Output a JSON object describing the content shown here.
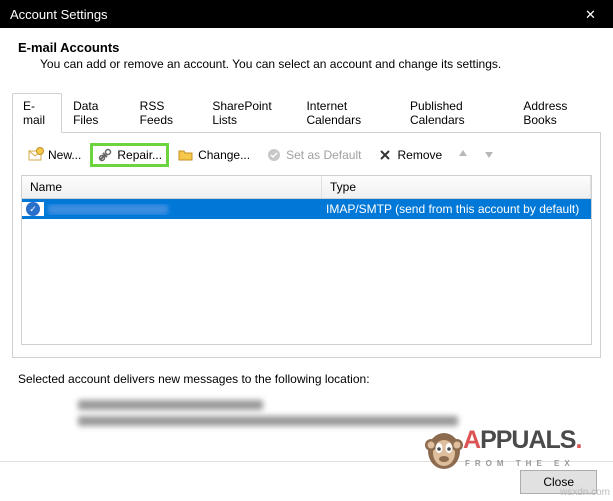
{
  "window": {
    "title": "Account Settings"
  },
  "header": {
    "title": "E-mail Accounts",
    "subtitle": "You can add or remove an account. You can select an account and change its settings."
  },
  "tabs": [
    {
      "label": "E-mail",
      "active": true
    },
    {
      "label": "Data Files",
      "active": false
    },
    {
      "label": "RSS Feeds",
      "active": false
    },
    {
      "label": "SharePoint Lists",
      "active": false
    },
    {
      "label": "Internet Calendars",
      "active": false
    },
    {
      "label": "Published Calendars",
      "active": false
    },
    {
      "label": "Address Books",
      "active": false
    }
  ],
  "toolbar": {
    "new_label": "New...",
    "repair_label": "Repair...",
    "change_label": "Change...",
    "set_default_label": "Set as Default",
    "remove_label": "Remove"
  },
  "list": {
    "columns": {
      "name": "Name",
      "type": "Type"
    },
    "rows": [
      {
        "name_redacted": true,
        "type": "IMAP/SMTP (send from this account by default)",
        "selected": true,
        "default": true
      }
    ]
  },
  "delivery": {
    "text": "Selected account delivers new messages to the following location:"
  },
  "footer": {
    "close_label": "Close"
  },
  "watermark": {
    "brand": "APPUALS",
    "brand_suffix": ".",
    "tagline": "FROM THE EX",
    "site": "wsxdn.com"
  }
}
